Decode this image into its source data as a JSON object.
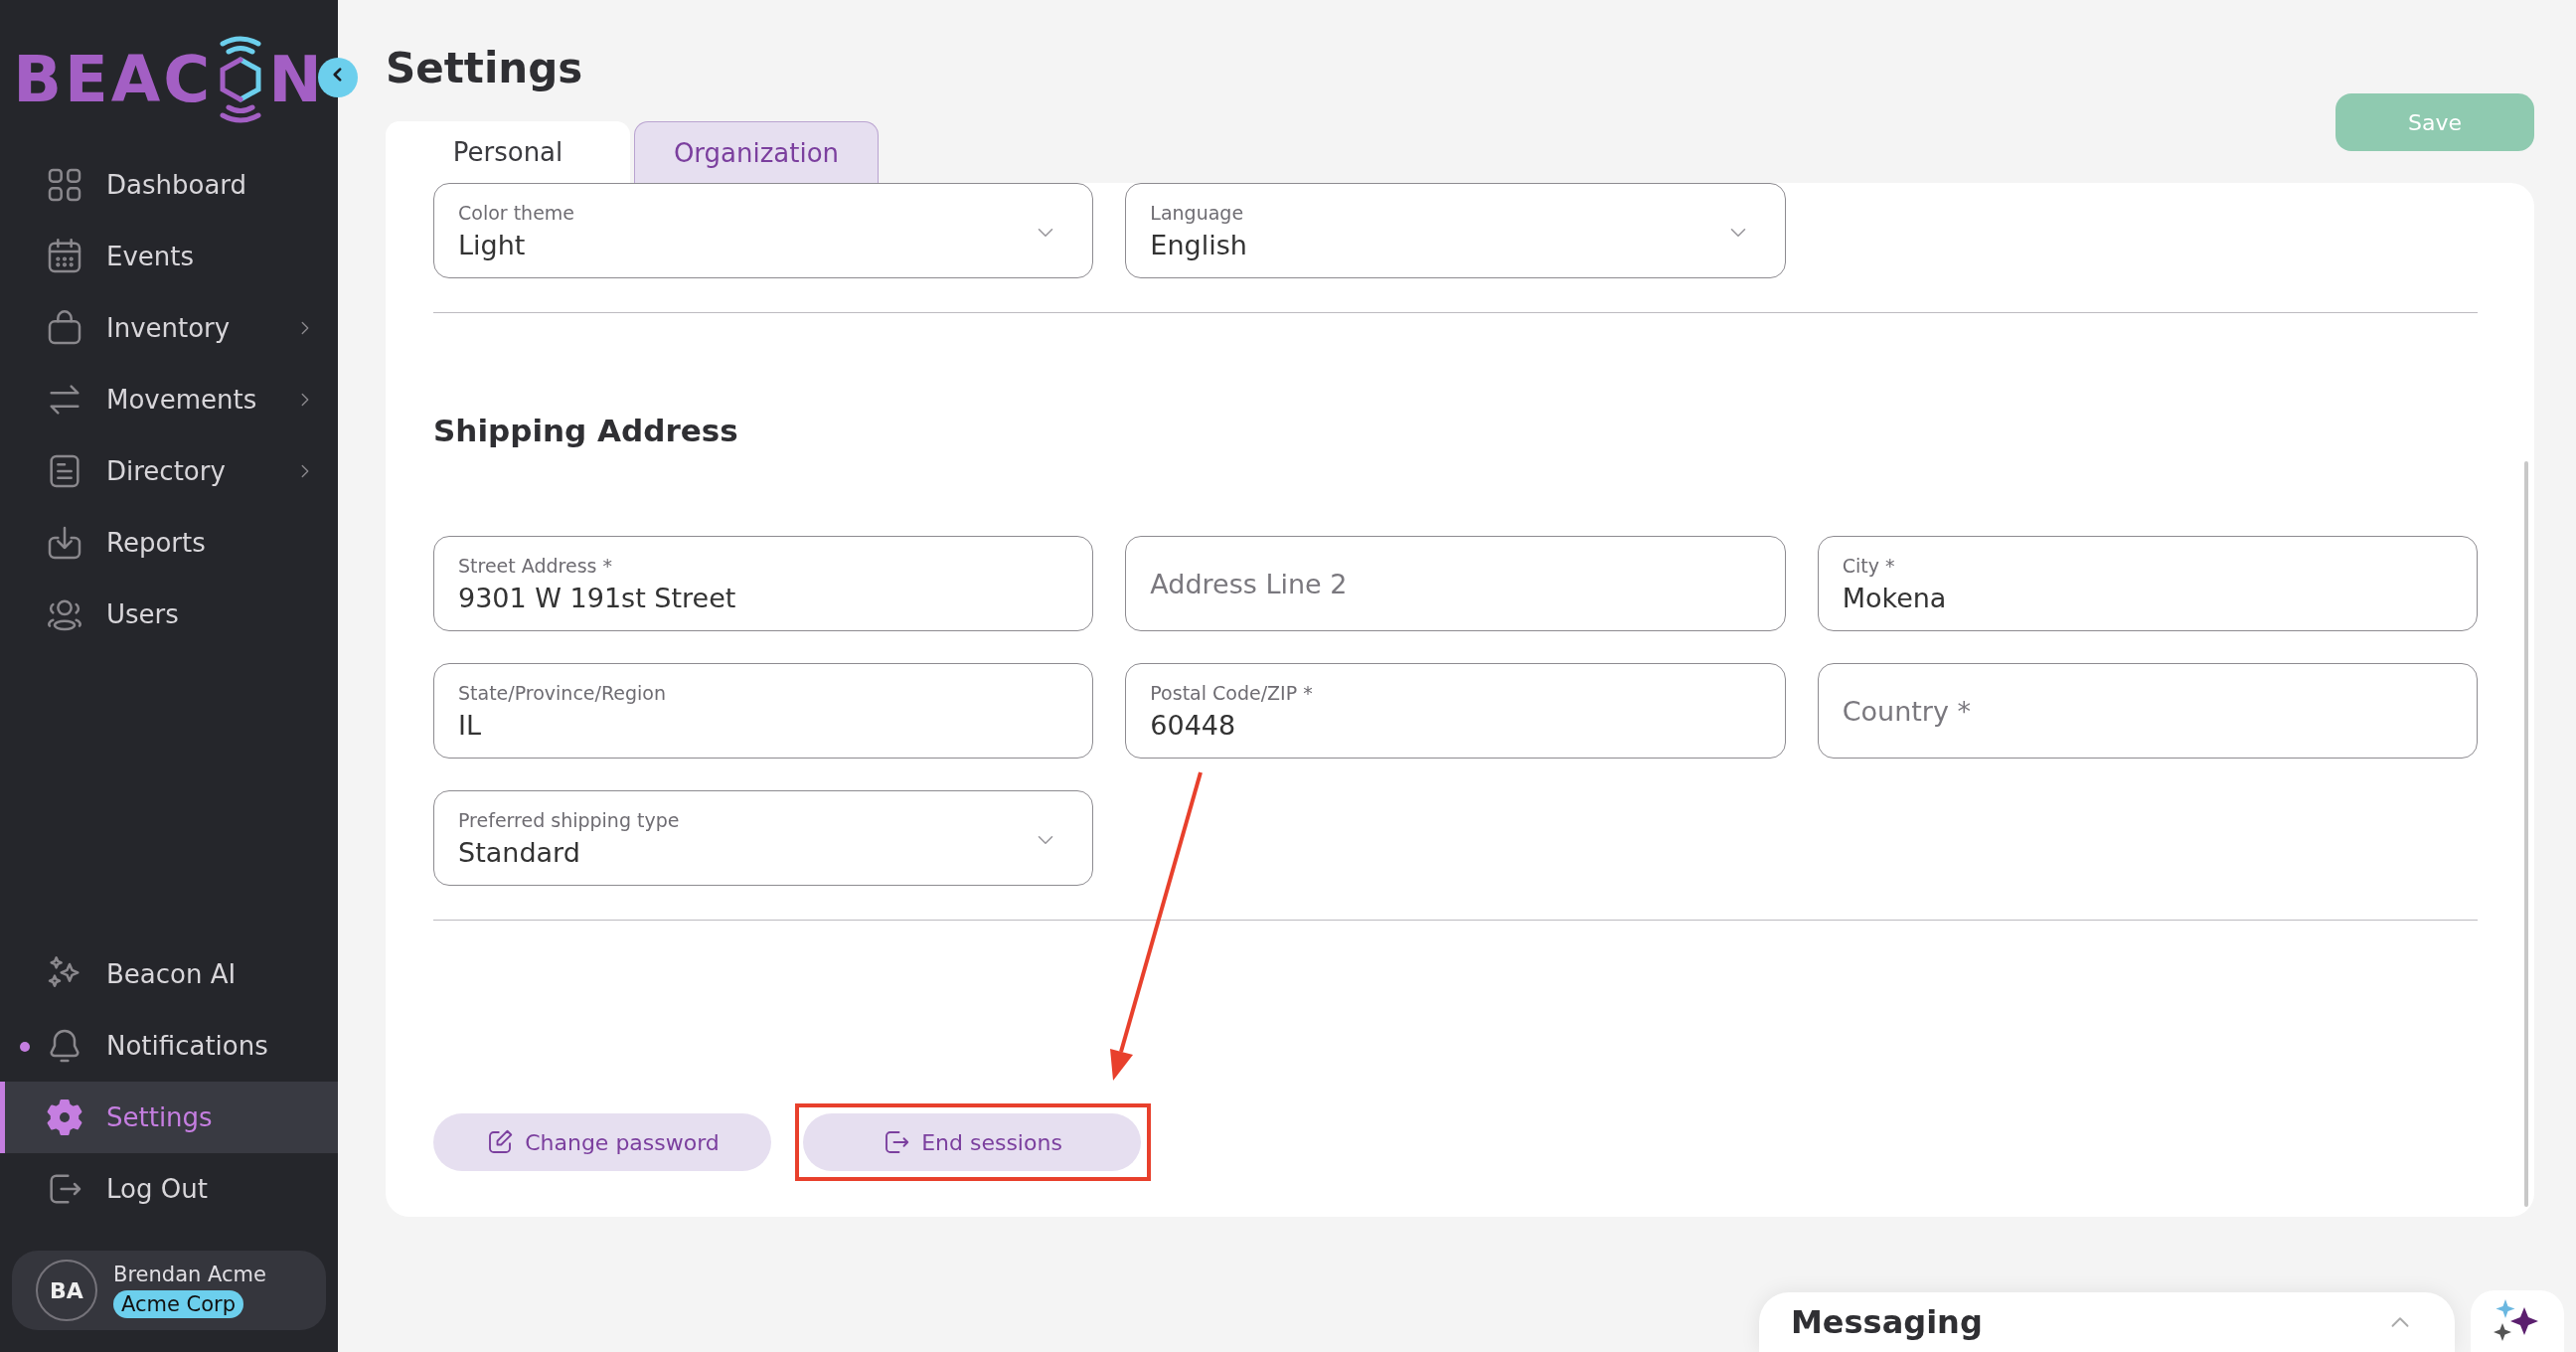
{
  "sidebar": {
    "logo": {
      "parts": [
        "BEAC",
        "N"
      ]
    },
    "nav_top": [
      {
        "label": "Dashboard",
        "expandable": false,
        "selected": false,
        "unread": false
      },
      {
        "label": "Events",
        "expandable": false,
        "selected": false,
        "unread": false
      },
      {
        "label": "Inventory",
        "expandable": true,
        "selected": false,
        "unread": false
      },
      {
        "label": "Movements",
        "expandable": true,
        "selected": false,
        "unread": false
      },
      {
        "label": "Directory",
        "expandable": true,
        "selected": false,
        "unread": false
      },
      {
        "label": "Reports",
        "expandable": false,
        "selected": false,
        "unread": false
      },
      {
        "label": "Users",
        "expandable": false,
        "selected": false,
        "unread": false
      }
    ],
    "nav_bottom": [
      {
        "label": "Beacon AI",
        "expandable": false,
        "selected": false,
        "unread": false
      },
      {
        "label": "Notifications",
        "expandable": false,
        "selected": false,
        "unread": true
      },
      {
        "label": "Settings",
        "expandable": false,
        "selected": true,
        "unread": false
      },
      {
        "label": "Log Out",
        "expandable": false,
        "selected": false,
        "unread": false
      }
    ],
    "user": {
      "initials": "BA",
      "name": "Brendan Acme",
      "org": "Acme Corp"
    }
  },
  "page": {
    "title": "Settings",
    "save_button": {
      "label": "Save",
      "disabled": true
    },
    "tabs": [
      {
        "label": "Personal",
        "selected": true
      },
      {
        "label": "Organization",
        "selected": false
      }
    ],
    "preferences": [
      {
        "kind": "select",
        "label": "Color theme",
        "value": "Light"
      },
      {
        "kind": "select",
        "label": "Language",
        "value": "English"
      }
    ],
    "section_title": "Shipping Address",
    "address_fields": [
      {
        "kind": "text",
        "label": "Street Address *",
        "value": "9301 W 191st Street"
      },
      {
        "kind": "text",
        "placeholder": "Address Line 2"
      },
      {
        "kind": "text",
        "label": "City *",
        "value": "Mokena"
      },
      {
        "kind": "text",
        "label": "State/Province/Region",
        "value": "IL"
      },
      {
        "kind": "text",
        "label": "Postal Code/ZIP *",
        "value": "60448"
      },
      {
        "kind": "text",
        "placeholder": "Country *"
      },
      {
        "kind": "select",
        "label": "Preferred shipping type",
        "value": "Standard"
      }
    ],
    "actions": [
      {
        "label": "Change password",
        "annotated": false
      },
      {
        "label": "End sessions",
        "annotated": true
      }
    ]
  },
  "messaging": {
    "title": "Messaging",
    "expanded": false
  }
}
